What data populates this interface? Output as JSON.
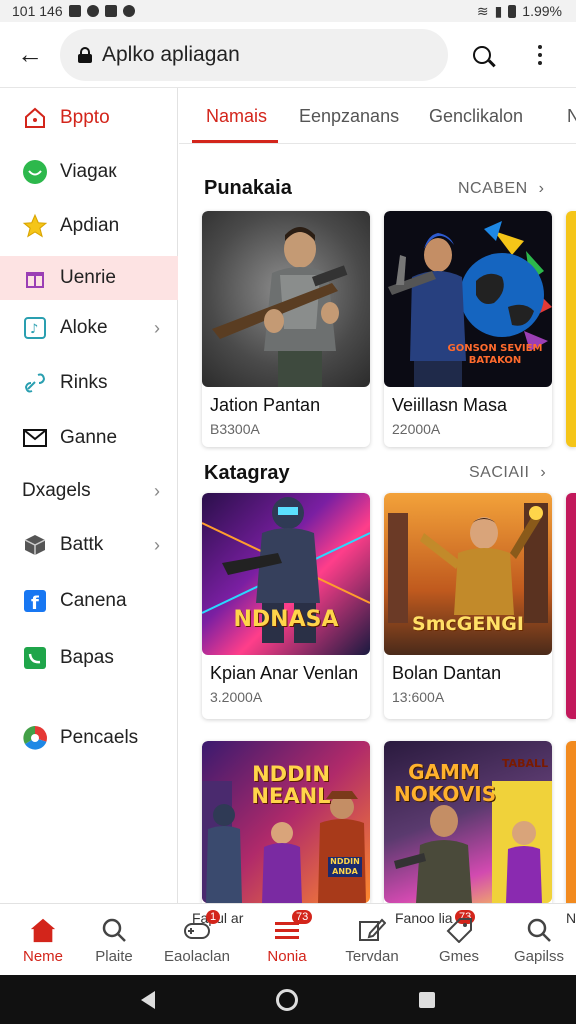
{
  "status_bar": {
    "time": "101 146",
    "battery": "1.99%"
  },
  "app_bar": {
    "url": "Aplko apliagan"
  },
  "sidebar": {
    "items": [
      {
        "label": "Bppto",
        "icon": "home-icon"
      },
      {
        "label": "Viagaк",
        "icon": "chat-icon"
      },
      {
        "label": "Apdian",
        "icon": "star-icon"
      },
      {
        "label": "Uenrie",
        "icon": "gift-icon"
      },
      {
        "label": "Aloke",
        "icon": "music-icon"
      },
      {
        "label": "Rinks",
        "icon": "link-icon"
      },
      {
        "label": "Ganne",
        "icon": "mail-icon"
      },
      {
        "label": "Dxagels",
        "icon": ""
      },
      {
        "label": "Battk",
        "icon": "box-icon"
      },
      {
        "label": "Canena",
        "icon": "facebook-icon"
      },
      {
        "label": "Bapas",
        "icon": "phone-icon"
      },
      {
        "label": "Pencaels",
        "icon": "color-wheel-icon"
      }
    ]
  },
  "tabs": [
    {
      "label": "Namais"
    },
    {
      "label": "Eenpzanans"
    },
    {
      "label": "Genclikalon"
    },
    {
      "label": "N"
    }
  ],
  "sections": [
    {
      "title": "Punakaia",
      "link": "NCABEN"
    },
    {
      "title": "Katagray",
      "link": "SACIAII"
    }
  ],
  "cards": [
    {
      "title": "Jation Pantan",
      "sub": "B3300A"
    },
    {
      "title": "Veiillasn Masa",
      "sub": "22000A"
    },
    {
      "title": "Kpian Anar Venlan",
      "sub": "3.2000A"
    },
    {
      "title": "Bolan Dantan",
      "sub": "13:600A"
    }
  ],
  "art": {
    "card2_text": "GONSON SEVIEM\nBATAKON",
    "card3_text": "NDNASA",
    "card4_text": "SmcGENGI",
    "card5_text": "NDDIN\nNEANL",
    "card5_small": "NDDIN\nANDA",
    "card6_text": "GAMM\nNOKOVIS",
    "card6_side": "TABALL"
  },
  "bottom_nav": {
    "items": [
      {
        "label": "Neme",
        "icon": "home-icon"
      },
      {
        "label": "Plaite",
        "icon": "search-icon"
      },
      {
        "label": "Eaolaclan",
        "icon": "gamepad-icon"
      },
      {
        "label": "Nonia",
        "icon": "menu-icon"
      },
      {
        "label": "Tervdan",
        "icon": "edit-icon"
      },
      {
        "label": "Gmes",
        "icon": "tag-icon"
      },
      {
        "label": "Gapilss",
        "icon": "search-icon"
      }
    ],
    "caption_left": "Fapul ar",
    "caption_right": "Fanoo lia",
    "badge_a": "1",
    "badge_b": "73",
    "badge_c": "73",
    "edge_letter": "N"
  },
  "colors": {
    "accent": "#d3251b",
    "active_bg": "#fde3e3"
  }
}
